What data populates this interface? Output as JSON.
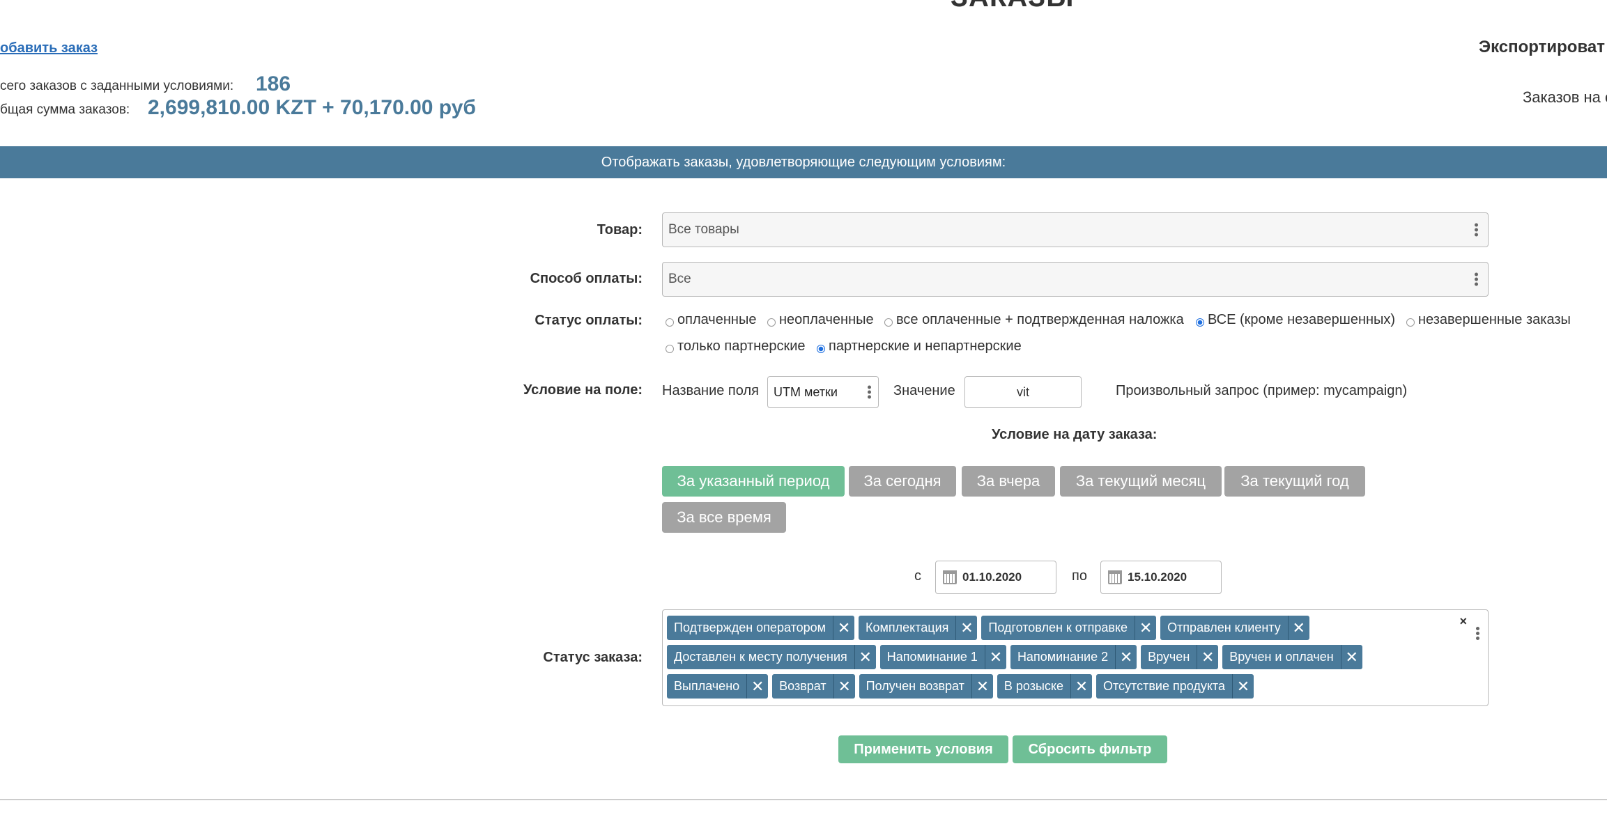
{
  "page": {
    "title": "ЗАКАЗЫ"
  },
  "header": {
    "add_order": "обавить заказ",
    "export": "Экспортироват",
    "orders_on": "Заказов на с"
  },
  "summary": {
    "count_label": "сего заказов с заданными условиями:",
    "count_value": "186",
    "sum_label": "бщая сумма заказов:",
    "sum_value": "2,699,810.00 KZT + 70,170.00 руб"
  },
  "filter": {
    "banner": "Отображать заказы, удовлетворяющие следующим условиям:",
    "product": {
      "label": "Товар:",
      "value": "Все товары"
    },
    "payment_method": {
      "label": "Способ оплаты:",
      "value": "Все"
    },
    "payment_status": {
      "label": "Статус оплаты:",
      "options": [
        {
          "label": "оплаченные",
          "selected": false
        },
        {
          "label": "неоплаченные",
          "selected": false
        },
        {
          "label": "все оплаченные + подтвержденная наложка",
          "selected": false
        },
        {
          "label": "ВСЕ (кроме незавершенных)",
          "selected": true
        },
        {
          "label": "незавершенные заказы",
          "selected": false
        }
      ],
      "partner_options": [
        {
          "label": "только партнерские",
          "selected": false
        },
        {
          "label": "партнерские и непартнерские",
          "selected": true
        }
      ]
    },
    "field_condition": {
      "label": "Условие на поле:",
      "field_name_label": "Название поля",
      "field_name_value": "UTM метки",
      "value_label": "Значение",
      "value": "vit",
      "hint": "Произвольный запрос (пример: mycampaign)"
    },
    "date_condition": {
      "label": "Условие на дату заказа:",
      "buttons": [
        {
          "label": "За указанный период",
          "active": true
        },
        {
          "label": "За сегодня",
          "active": false
        },
        {
          "label": "За вчера",
          "active": false
        },
        {
          "label": "За текущий месяц",
          "active": false
        },
        {
          "label": "За текущий год",
          "active": false
        },
        {
          "label": "За все время",
          "active": false
        }
      ],
      "from_label": "с",
      "from_value": "01.10.2020",
      "to_label": "по",
      "to_value": "15.10.2020"
    },
    "order_status": {
      "label": "Статус заказа:",
      "clear": "×",
      "tags": [
        "Подтвержден оператором",
        "Комплектация",
        "Подготовлен к отправке",
        "Отправлен клиенту",
        "Доставлен к месту получения",
        "Напоминание 1",
        "Напоминание 2",
        "Вручен",
        "Вручен и оплачен",
        "Выплачено",
        "Возврат",
        "Получен возврат",
        "В розыске",
        "Отсутствие продукта"
      ]
    },
    "apply_label": "Применить условия",
    "reset_label": "Сбросить фильтр"
  },
  "colors": {
    "accent": "#4a7a9a",
    "button_green": "#6fbf96",
    "button_gray": "#a3a3a3",
    "link": "#2a6db8"
  }
}
